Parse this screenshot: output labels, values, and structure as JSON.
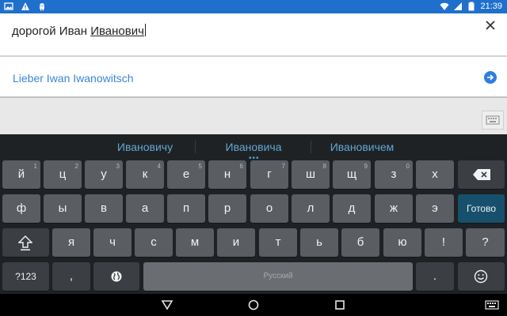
{
  "status_bar": {
    "time": "21:39",
    "left_icons": [
      "image-icon",
      "warning-icon",
      "android-icon"
    ],
    "right_icons": [
      "wifi-icon",
      "signal-icon",
      "battery-icon"
    ]
  },
  "input": {
    "committed_text": "дорогой Иван ",
    "composing_text": "Иванович"
  },
  "translation": {
    "text": "Lieber Iwan Iwanowitsch"
  },
  "keyboard": {
    "suggestions": [
      "Ивановичу",
      "Ивановича",
      "Ивановичем"
    ],
    "more_indicator": "•••",
    "row1": [
      {
        "label": "й",
        "hint": "1"
      },
      {
        "label": "ц",
        "hint": "2"
      },
      {
        "label": "у",
        "hint": "3"
      },
      {
        "label": "к",
        "hint": "4"
      },
      {
        "label": "е",
        "hint": "5"
      },
      {
        "label": "н",
        "hint": "6"
      },
      {
        "label": "г",
        "hint": "7"
      },
      {
        "label": "ш",
        "hint": "8"
      },
      {
        "label": "щ",
        "hint": "9"
      },
      {
        "label": "з",
        "hint": "0"
      },
      {
        "label": "х",
        "hint": ""
      }
    ],
    "row2": [
      "ф",
      "ы",
      "в",
      "а",
      "п",
      "р",
      "о",
      "л",
      "д",
      "ж",
      "э"
    ],
    "done_label": "Готово",
    "row3": [
      "я",
      "ч",
      "с",
      "м",
      "и",
      "т",
      "ь",
      "б",
      "ю",
      "!",
      "?"
    ],
    "symbols_label": "?123",
    "comma_label": ",",
    "space_label": "Русский",
    "period_label": "."
  },
  "colors": {
    "status_bar": "#1f70cc",
    "accent": "#3b86d6",
    "keyboard_bg": "#1f2224",
    "key": "#5a5d61",
    "done_key": "#17506c"
  }
}
